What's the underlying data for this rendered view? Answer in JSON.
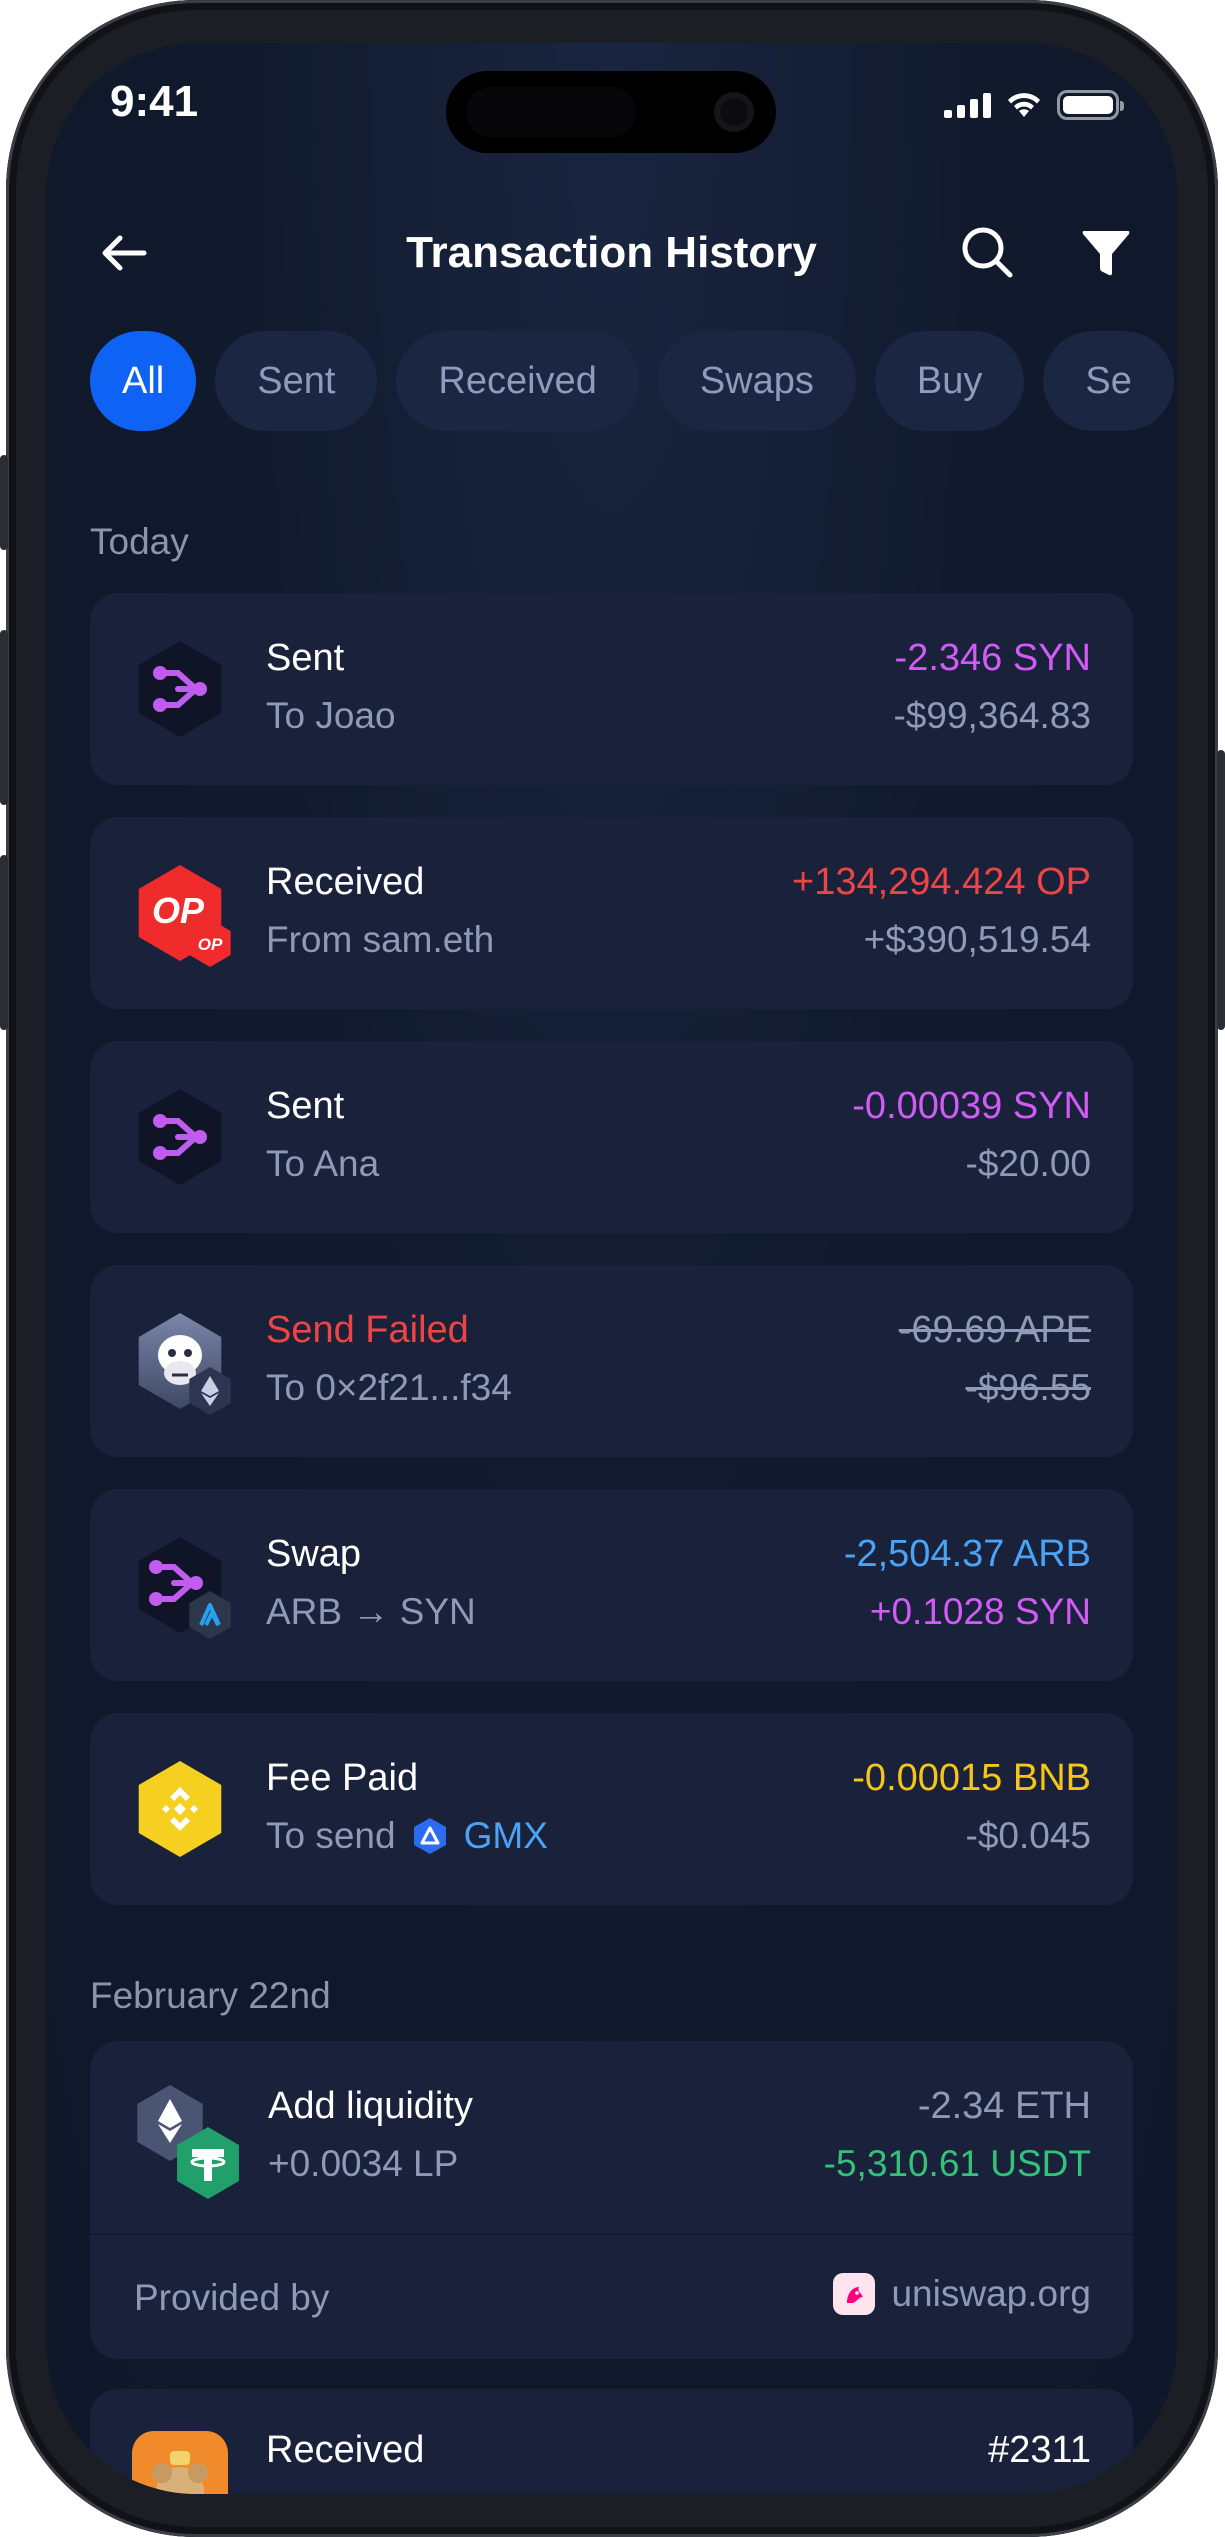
{
  "status_bar": {
    "time": "9:41"
  },
  "header": {
    "title": "Transaction History"
  },
  "tabs": [
    {
      "label": "All",
      "active": true
    },
    {
      "label": "Sent"
    },
    {
      "label": "Received"
    },
    {
      "label": "Swaps"
    },
    {
      "label": "Buy"
    },
    {
      "label": "Se"
    }
  ],
  "sections": {
    "today": "Today",
    "feb": "February 22nd"
  },
  "transactions": [
    {
      "title": "Sent",
      "subtitle": "To Joao",
      "amount": "-2.346 SYN",
      "fiat": "-$99,364.83",
      "icon": "synapse-icon"
    },
    {
      "title": "Received",
      "subtitle": "From sam.eth",
      "amount": "+134,294.424 OP",
      "fiat": "+$390,519.54",
      "icon": "optimism-icon"
    },
    {
      "title": "Sent",
      "subtitle": "To Ana",
      "amount": "-0.00039 SYN",
      "fiat": "-$20.00",
      "icon": "synapse-icon"
    },
    {
      "title": "Send Failed",
      "subtitle": "To 0×2f21...f34",
      "amount": "-69.69 APE",
      "fiat": "-$96.55",
      "icon": "apecoin-icon"
    },
    {
      "title": "Swap",
      "subtitle": "ARB → SYN",
      "amount": "-2,504.37 ARB",
      "fiat": "+0.1028 SYN",
      "icon": "synapse-icon"
    },
    {
      "title": "Fee Paid",
      "subtitle_prefix": "To send",
      "subtitle_token": "GMX",
      "amount": "-0.00015 BNB",
      "fiat": "-$0.045",
      "icon": "bnb-icon"
    }
  ],
  "liquidity": {
    "title": "Add liquidity",
    "subtitle": "+0.0034 LP",
    "amount": "-2.34 ETH",
    "fiat": "-5,310.61 USDT",
    "provided_label": "Provided by",
    "provider": "uniswap.org"
  },
  "last": {
    "title": "Received",
    "amount": "#2311"
  },
  "colors": {
    "accent": "#0e63f5",
    "background": "#0f172a",
    "card": "#19223a",
    "syn": "#d05cf5",
    "op": "#ef4444",
    "arb": "#4aa3f5",
    "bnb": "#f5c518",
    "usdt": "#34c27a"
  }
}
